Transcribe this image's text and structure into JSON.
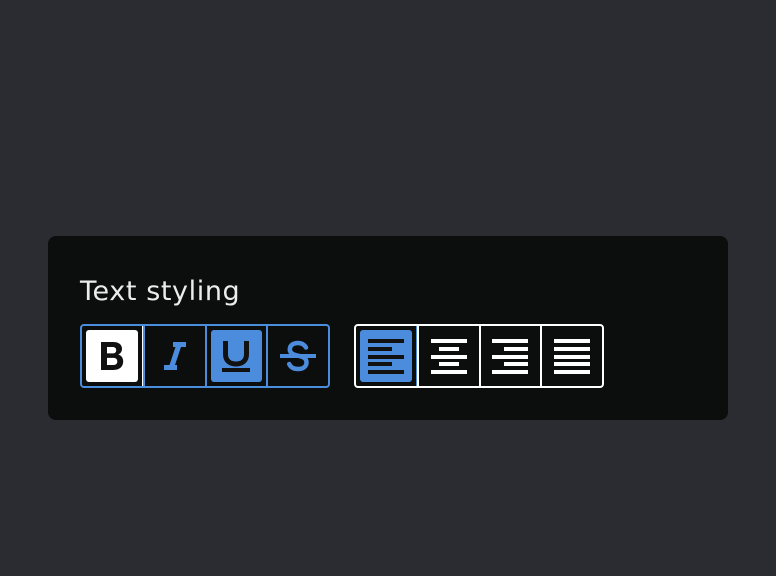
{
  "panel": {
    "title": "Text styling"
  },
  "style_group": {
    "buttons": [
      {
        "name": "bold",
        "icon": "bold-icon",
        "active": true
      },
      {
        "name": "italic",
        "icon": "italic-icon",
        "active": false
      },
      {
        "name": "underline",
        "icon": "underline-icon",
        "active": true
      },
      {
        "name": "strikethrough",
        "icon": "strikethrough-icon",
        "active": false
      }
    ]
  },
  "align_group": {
    "buttons": [
      {
        "name": "align-left",
        "icon": "align-left-icon",
        "active": true
      },
      {
        "name": "align-center",
        "icon": "align-center-icon",
        "active": false
      },
      {
        "name": "align-right",
        "icon": "align-right-icon",
        "active": false
      },
      {
        "name": "align-justify",
        "icon": "align-justify-icon",
        "active": false
      }
    ]
  },
  "colors": {
    "page_background": "#2a2c31",
    "panel_background": "#0c0d0d",
    "accent": "#4c8cdc",
    "foreground": "#ffffff",
    "title_text": "#ececec"
  }
}
